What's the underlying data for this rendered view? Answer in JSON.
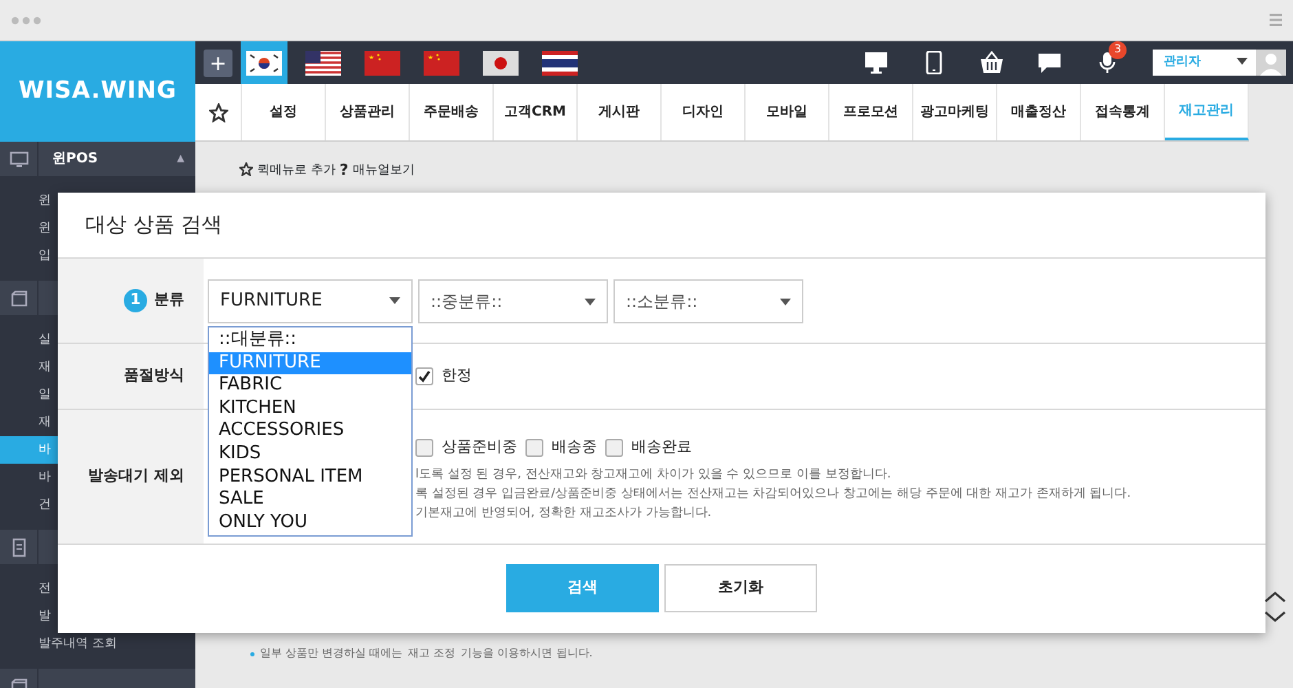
{
  "logo": "WISA.WING",
  "flags": [
    {
      "kind": "kr",
      "selected": true
    },
    {
      "kind": "us",
      "selected": false
    },
    {
      "kind": "cn",
      "selected": false
    },
    {
      "kind": "cn",
      "selected": false
    },
    {
      "kind": "jp",
      "selected": false
    },
    {
      "kind": "th",
      "selected": false
    }
  ],
  "add_button": "+",
  "notification_count": "3",
  "user": {
    "name": "관리자"
  },
  "nav": [
    {
      "label": "설정",
      "selected": false
    },
    {
      "label": "상품관리",
      "selected": false
    },
    {
      "label": "주문배송",
      "selected": false
    },
    {
      "label": "고객CRM",
      "selected": false
    },
    {
      "label": "게시판",
      "selected": false
    },
    {
      "label": "디자인",
      "selected": false
    },
    {
      "label": "모바일",
      "selected": false
    },
    {
      "label": "프로모션",
      "selected": false
    },
    {
      "label": "광고마케팅",
      "selected": false
    },
    {
      "label": "매출정산",
      "selected": false
    },
    {
      "label": "접속통계",
      "selected": false
    },
    {
      "label": "재고관리",
      "selected": true
    }
  ],
  "quick_links": [
    {
      "kind": "star",
      "label": "퀵메뉴로 추가"
    },
    {
      "kind": "help",
      "mark": "?",
      "label": "매뉴얼보기"
    }
  ],
  "sidebar": [
    {
      "kind": "monitor",
      "label": "윈POS",
      "toggle": "▲",
      "items": [
        {
          "label": "윈",
          "selected": false
        },
        {
          "label": "윈",
          "selected": false
        },
        {
          "label": "입",
          "selected": false
        }
      ]
    },
    {
      "kind": "box",
      "items": [
        {
          "label": "실",
          "selected": false
        },
        {
          "label": "재",
          "selected": false
        },
        {
          "label": "일",
          "selected": false
        },
        {
          "label": "재",
          "selected": false
        },
        {
          "label": "바",
          "selected": true
        },
        {
          "label": "바",
          "selected": false
        },
        {
          "label": "건",
          "selected": false
        }
      ]
    },
    {
      "kind": "document",
      "items": [
        {
          "label": "전",
          "selected": false
        },
        {
          "label": "발",
          "selected": false
        },
        {
          "label": "발주내역 조회",
          "selected": false
        }
      ]
    },
    {
      "kind": "box"
    }
  ],
  "modal": {
    "title": "대상 상품 검색",
    "rows": [
      {
        "kind": "category",
        "step": "1",
        "label": "분류",
        "selects": [
          {
            "value": "FURNITURE"
          },
          {
            "value": "::중분류::"
          },
          {
            "value": "::소분류::"
          }
        ],
        "dropdown": [
          {
            "label": "::대분류::",
            "selected": false
          },
          {
            "label": "FURNITURE",
            "selected": true
          },
          {
            "label": "FABRIC",
            "selected": false
          },
          {
            "label": "KITCHEN",
            "selected": false
          },
          {
            "label": "ACCESSORIES",
            "selected": false
          },
          {
            "label": "KIDS",
            "selected": false
          },
          {
            "label": "PERSONAL ITEM",
            "selected": false
          },
          {
            "label": "SALE",
            "selected": false
          },
          {
            "label": "ONLY YOU",
            "selected": false
          }
        ]
      },
      {
        "kind": "checks",
        "label": "품절방식",
        "options": [
          {
            "label": "한정",
            "checked": true
          }
        ]
      },
      {
        "kind": "checks",
        "label": "발송대기 제외",
        "options": [
          {
            "label": "상품준비중",
            "checked": false
          },
          {
            "label": "배송중",
            "checked": false
          },
          {
            "label": "배송완료",
            "checked": false
          }
        ],
        "notes": [
          "l도록 설정 된 경우, 전산재고와 창고재고에 차이가 있을 수 있으므로 이를 보정합니다.",
          "록 설정된 경우 입금완료/상품준비중 상태에서는 전산재고는 차감되어있으나 창고에는 해당 주문에 대한 재고가 존재하게 됩니다.",
          "기본재고에 반영되어, 정확한 재고조사가 가능합니다."
        ]
      }
    ],
    "buttons": [
      {
        "kind": "primary",
        "label": "검색"
      },
      {
        "kind": "secondary",
        "label": "초기화"
      }
    ]
  },
  "page_note": {
    "before": "일부 상품만 변경하실 때에는",
    "link": "재고 조정",
    "after": "기능을 이용하시면 됩니다."
  }
}
